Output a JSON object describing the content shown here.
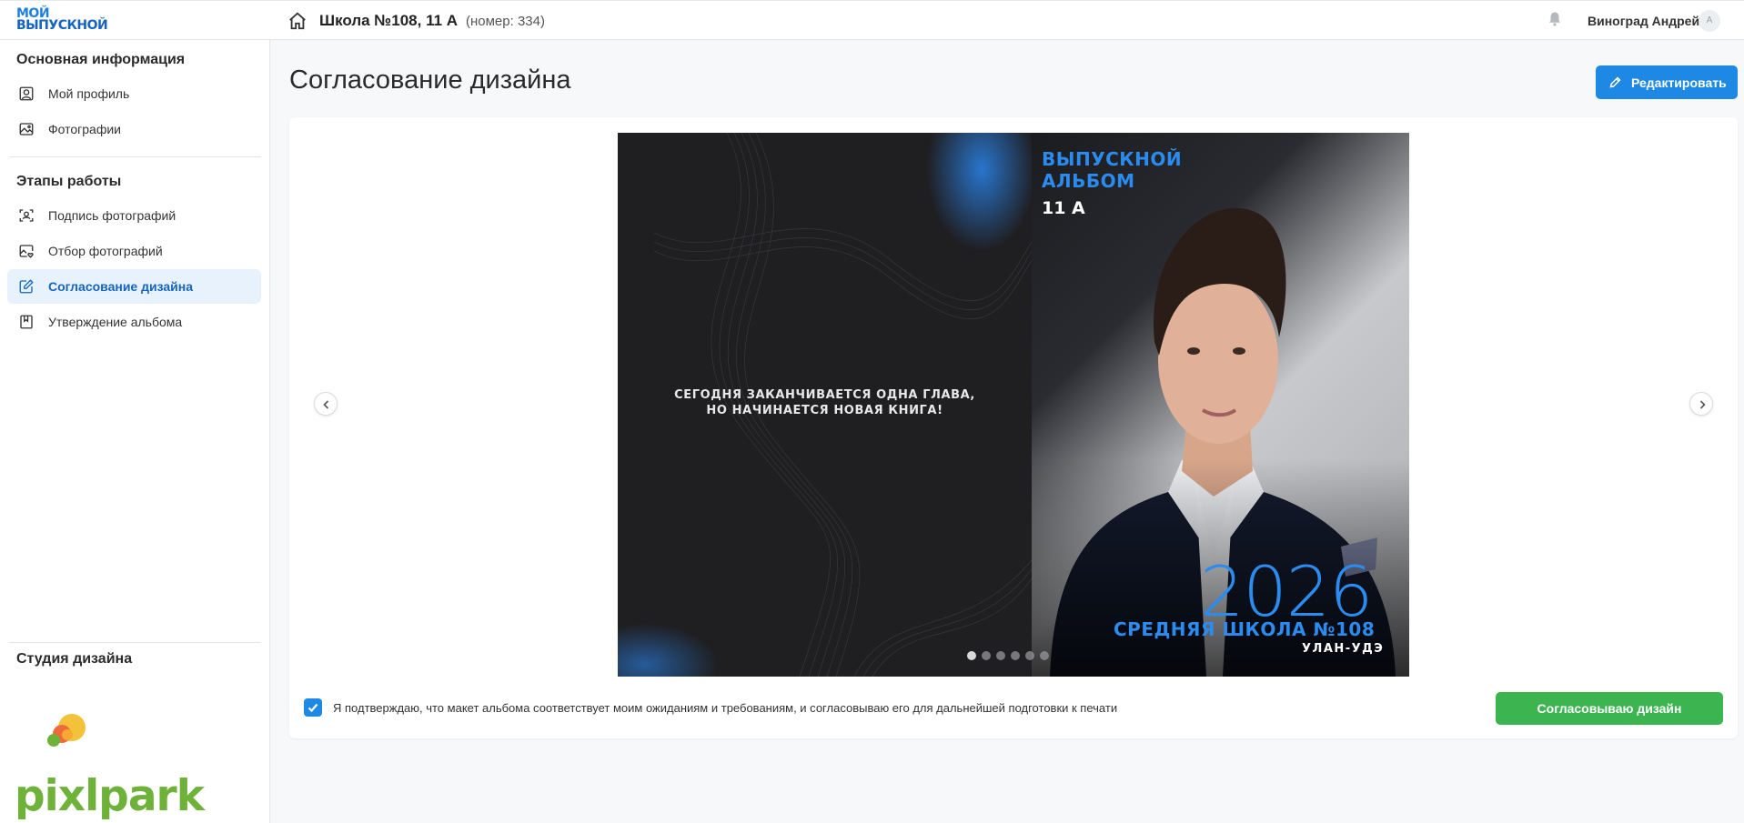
{
  "header": {
    "logo_line1": "Мой",
    "logo_line2": "Выпускной",
    "school_title": "Школа №108, 11 А",
    "school_number": "(номер: 334)",
    "user_name": "Виноград Андрей",
    "avatar_initial": "А"
  },
  "sidebar": {
    "section_main": "Основная информация",
    "main_items": [
      {
        "label": "Мой профиль",
        "icon": "user-icon"
      },
      {
        "label": "Фотографии",
        "icon": "image-icon"
      }
    ],
    "section_stages": "Этапы работы",
    "stage_items": [
      {
        "label": "Подпись фотографий",
        "icon": "face-scan-icon"
      },
      {
        "label": "Отбор фотографий",
        "icon": "image-heart-icon"
      },
      {
        "label": "Согласование дизайна",
        "icon": "edit-icon",
        "active": true
      },
      {
        "label": "Утверждение альбома",
        "icon": "book-icon"
      }
    ],
    "section_studio": "Студия дизайна",
    "studio_logo_text": "pixlpark"
  },
  "main": {
    "page_title": "Согласование дизайна",
    "edit_button": "Редактировать",
    "spread": {
      "quote_line1": "СЕГОДНЯ ЗАКАНЧИВАЕТСЯ ОДНА ГЛАВА,",
      "quote_line2": "НО НАЧИНАЕТСЯ НОВАЯ КНИГА!",
      "album_line1": "ВЫПУСКНОЙ",
      "album_line2": "АЛЬБОМ",
      "album_class": "11 А",
      "year": "2026",
      "school": "СРЕДНЯЯ ШКОЛА №108",
      "city": "УЛАН-УДЭ",
      "slide_count": 6,
      "active_slide": 1
    },
    "confirm_text": "Я подтверждаю, что макет альбома соответствует моим ожиданиям и требованиям, и согласовываю его для дальнейшей подготовки к печати",
    "confirm_checked": true,
    "approve_button": "Согласовываю дизайн"
  },
  "colors": {
    "accent": "#1e88e5",
    "approve": "#3cb550",
    "active_bg": "#e8f2fc",
    "brand_green": "#6fb23a"
  }
}
